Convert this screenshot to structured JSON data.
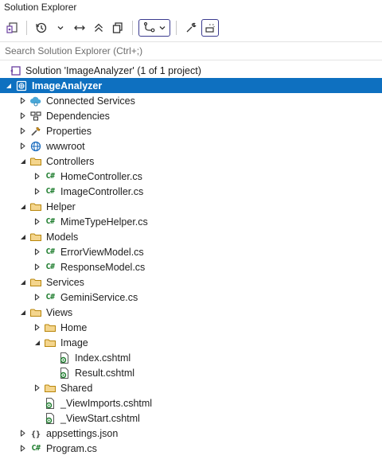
{
  "window": {
    "title": "Solution Explorer"
  },
  "toolbar": {
    "buttons": [
      "switch-views-icon",
      "history-icon",
      "chevron-down-icon",
      "sync-icon",
      "collapse-all-icon",
      "copy-icon",
      "filter-icon",
      "chevron-down-icon",
      "wrench-icon",
      "preview-icon"
    ]
  },
  "search": {
    "placeholder": "Search Solution Explorer (Ctrl+;)"
  },
  "tree": [
    {
      "label": "Solution 'ImageAnalyzer' (1 of 1 project)",
      "icon": "solution-icon",
      "depth": 0,
      "expander": "none"
    },
    {
      "label": "ImageAnalyzer",
      "icon": "project-icon",
      "depth": 0,
      "expander": "expanded",
      "selected": true
    },
    {
      "label": "Connected Services",
      "icon": "connected-services-icon",
      "depth": 1,
      "expander": "collapsed"
    },
    {
      "label": "Dependencies",
      "icon": "dependencies-icon",
      "depth": 1,
      "expander": "collapsed"
    },
    {
      "label": "Properties",
      "icon": "properties-icon",
      "depth": 1,
      "expander": "collapsed"
    },
    {
      "label": "wwwroot",
      "icon": "globe-icon",
      "depth": 1,
      "expander": "collapsed"
    },
    {
      "label": "Controllers",
      "icon": "folder-icon",
      "depth": 1,
      "expander": "expanded"
    },
    {
      "label": "HomeController.cs",
      "icon": "csharp-icon",
      "depth": 2,
      "expander": "collapsed"
    },
    {
      "label": "ImageController.cs",
      "icon": "csharp-icon",
      "depth": 2,
      "expander": "collapsed"
    },
    {
      "label": "Helper",
      "icon": "folder-icon",
      "depth": 1,
      "expander": "expanded"
    },
    {
      "label": "MimeTypeHelper.cs",
      "icon": "csharp-icon",
      "depth": 2,
      "expander": "collapsed"
    },
    {
      "label": "Models",
      "icon": "folder-icon",
      "depth": 1,
      "expander": "expanded"
    },
    {
      "label": "ErrorViewModel.cs",
      "icon": "csharp-icon",
      "depth": 2,
      "expander": "collapsed"
    },
    {
      "label": "ResponseModel.cs",
      "icon": "csharp-icon",
      "depth": 2,
      "expander": "collapsed"
    },
    {
      "label": "Services",
      "icon": "folder-icon",
      "depth": 1,
      "expander": "expanded"
    },
    {
      "label": "GeminiService.cs",
      "icon": "csharp-icon",
      "depth": 2,
      "expander": "collapsed"
    },
    {
      "label": "Views",
      "icon": "folder-icon",
      "depth": 1,
      "expander": "expanded"
    },
    {
      "label": "Home",
      "icon": "folder-icon",
      "depth": 2,
      "expander": "collapsed"
    },
    {
      "label": "Image",
      "icon": "folder-icon",
      "depth": 2,
      "expander": "expanded"
    },
    {
      "label": "Index.cshtml",
      "icon": "razor-icon",
      "depth": 3,
      "expander": "none"
    },
    {
      "label": "Result.cshtml",
      "icon": "razor-icon",
      "depth": 3,
      "expander": "none"
    },
    {
      "label": "Shared",
      "icon": "folder-icon",
      "depth": 2,
      "expander": "collapsed"
    },
    {
      "label": "_ViewImports.cshtml",
      "icon": "razor-icon",
      "depth": 2,
      "expander": "none"
    },
    {
      "label": "_ViewStart.cshtml",
      "icon": "razor-icon",
      "depth": 2,
      "expander": "none"
    },
    {
      "label": "appsettings.json",
      "icon": "json-icon",
      "depth": 1,
      "expander": "collapsed"
    },
    {
      "label": "Program.cs",
      "icon": "csharp-icon",
      "depth": 1,
      "expander": "collapsed"
    }
  ]
}
